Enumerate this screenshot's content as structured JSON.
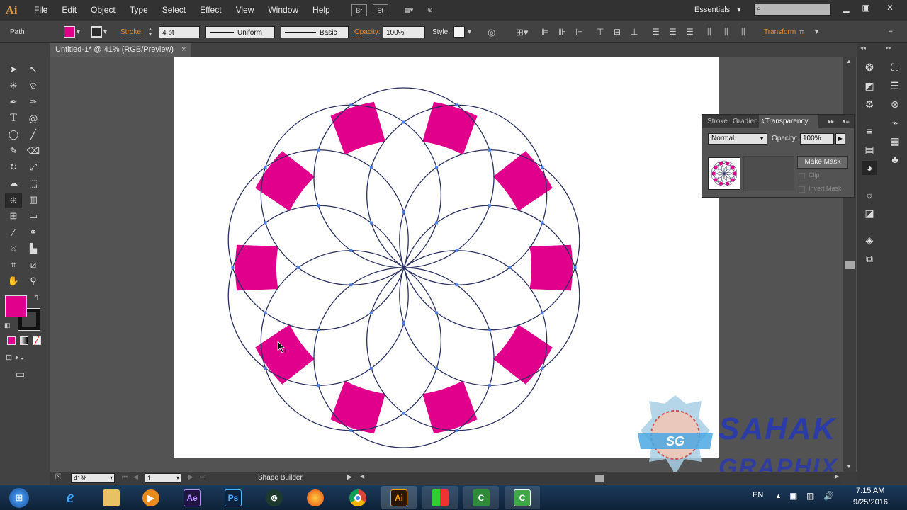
{
  "app": {
    "logo": "Ai"
  },
  "menubar": {
    "items": [
      "File",
      "Edit",
      "Object",
      "Type",
      "Select",
      "Effect",
      "View",
      "Window",
      "Help"
    ],
    "bridge_label": "Br",
    "stock_label": "St",
    "workspace": "Essentials",
    "search_placeholder": ""
  },
  "controlbar": {
    "selection_label": "Path",
    "fill_color": "#e0008c",
    "stroke_label": "Stroke:",
    "stroke_weight": "4 pt",
    "profile_label": "Uniform",
    "brush_label": "Basic",
    "opacity_label": "Opacity:",
    "opacity_value": "100%",
    "style_label": "Style:",
    "transform_label": "Transform"
  },
  "document": {
    "tab_title": "Untitled-1* @ 41% (RGB/Preview)",
    "close_glyph": "×"
  },
  "tools": {
    "fill_color": "#e0008c",
    "stroke_color": "#1a1a1a",
    "icons": [
      "selection-tool-icon",
      "direct-selection-tool-icon",
      "magic-wand-tool-icon",
      "lasso-tool-icon",
      "pen-tool-icon",
      "curvature-tool-icon",
      "type-tool-icon",
      "spiral-tool-icon",
      "ellipse-tool-icon",
      "brush-tool-icon",
      "pencil-tool-icon",
      "eraser-tool-icon",
      "rotate-tool-icon",
      "scale-tool-icon",
      "warp-tool-icon",
      "free-transform-tool-icon",
      "shape-builder-tool-icon",
      "chart-tool-icon",
      "mesh-tool-icon",
      "gradient-tool-icon",
      "eyedropper-tool-icon",
      "blend-tool-icon",
      "symbol-sprayer-tool-icon",
      "column-graph-tool-icon",
      "artboard-tool-icon",
      "slice-tool-icon",
      "hand-tool-icon",
      "zoom-tool-icon"
    ]
  },
  "transparency_panel": {
    "tabs": [
      "Stroke",
      "Gradien",
      "Transparency"
    ],
    "active_tab": "Transparency",
    "blend_mode": "Normal",
    "opacity_label": "Opacity:",
    "opacity_value": "100%",
    "make_mask_label": "Make Mask",
    "clip_label": "Clip",
    "invert_mask_label": "Invert Mask"
  },
  "statusbar": {
    "zoom_value": "41%",
    "artboard_number": "1",
    "tool_name": "Shape Builder"
  },
  "artwork": {
    "petal_color": "#e0008c",
    "line_color": "#2a3060",
    "anchor_color": "#4d7fe8"
  },
  "watermark": {
    "line1": "SAHAK",
    "line2": "GRAPHIX",
    "badge": "SG"
  },
  "taskbar": {
    "language": "EN",
    "time": "7:15 AM",
    "date": "9/25/2016",
    "apps": [
      "Start",
      "Internet Explorer",
      "File Explorer",
      "Media Player",
      "After Effects",
      "Photoshop",
      "Camtasia Recorder",
      "Firefox",
      "Chrome",
      "Illustrator",
      "App",
      "Camtasia Studio",
      "Camtasia"
    ],
    "ae_label": "Ae",
    "ps_label": "Ps",
    "ai_label": "Ai"
  }
}
